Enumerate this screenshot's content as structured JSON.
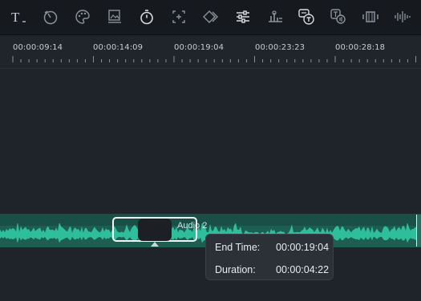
{
  "toolbar": {
    "tools": [
      {
        "icon": "text-tool-icon",
        "label": "T"
      },
      {
        "icon": "speed-icon"
      },
      {
        "icon": "color-palette-icon"
      },
      {
        "icon": "image-frame-icon"
      },
      {
        "icon": "timer-icon"
      },
      {
        "icon": "crop-icon"
      },
      {
        "icon": "keyframe-icon"
      },
      {
        "icon": "adjust-sliders-icon"
      },
      {
        "icon": "audio-mixer-icon"
      },
      {
        "icon": "speech-to-text-icon"
      },
      {
        "icon": "text-to-speech-icon"
      },
      {
        "icon": "clip-split-icon"
      },
      {
        "icon": "audio-waveform-icon"
      }
    ]
  },
  "ruler": {
    "timecodes": [
      "00:00:09:14",
      "00:00:14:09",
      "00:00:19:04",
      "00:00:23:23",
      "00:00:28:18"
    ]
  },
  "audio_track": {
    "clip_label": "Audio 2",
    "clip_color": "#2fbe9b"
  },
  "tooltip": {
    "end_time_label": "End Time:",
    "end_time_value": "00:00:19:04",
    "duration_label": "Duration:",
    "duration_value": "00:00:04:22"
  }
}
